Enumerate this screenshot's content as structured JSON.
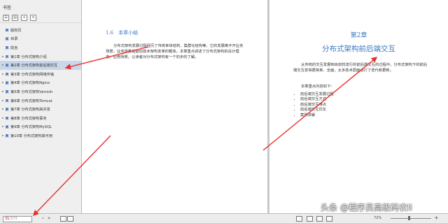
{
  "sidebar": {
    "title": "书签",
    "items": [
      {
        "label": "版权页",
        "expand": ""
      },
      {
        "label": "目录",
        "expand": ""
      },
      {
        "label": "前言",
        "expand": ""
      },
      {
        "label": "第1章 分布式架构介绍",
        "expand": "▸"
      },
      {
        "label": "第2章 分布式架构前后端交互",
        "expand": "▸",
        "selected": true
      },
      {
        "label": "第3章 分布式架构网络传输",
        "expand": "▸"
      },
      {
        "label": "第4章 分布式架构Nginx",
        "expand": "▸"
      },
      {
        "label": "第5章 分布式架构Varnish",
        "expand": "▸"
      },
      {
        "label": "第6章 分布式架构Tomcat",
        "expand": "▸"
      },
      {
        "label": "第7章 分布式架构高并发",
        "expand": "▸"
      },
      {
        "label": "第8章 分布式架构事务",
        "expand": "▸"
      },
      {
        "label": "第9章 分布式架构MySQL",
        "expand": "▸"
      },
      {
        "label": "第10章 分布式架构高可用",
        "expand": "▸"
      }
    ]
  },
  "left_page": {
    "section_title": "1.6　本章小结",
    "paragraph": "分布式架构发展过程经历了传统单体结构、集群化结构等，它的发展离不开业务场景，业务场景是驱动技术架构变革的载体。本章重点讲述了分布式架构的设计理念、应用场景，让读者对分布式架构有一个初步的了解。"
  },
  "right_page": {
    "chapter_number": "第2章",
    "chapter_title": "分布式架构前后端交互",
    "intro": "从传统的交互发展到目前较流行的前后端交互的过程中，分布式架构下的前后端交互变得更简单、全面，太多技术层面进行了迭代和更新。",
    "focus_heading": "本章重点内容如下：",
    "key_points": [
      "前后端交互发展过程",
      "前后端交互方式",
      "前后端交互难点",
      "前后端交互优化",
      "案例讲解"
    ]
  },
  "status_bar": {
    "page_current": "31",
    "page_total": "/373",
    "zoom": "72%"
  },
  "watermark": "头条 @程序员高级码农II",
  "colors": {
    "accent": "#3a78c2",
    "arrow": "#e8302a"
  }
}
